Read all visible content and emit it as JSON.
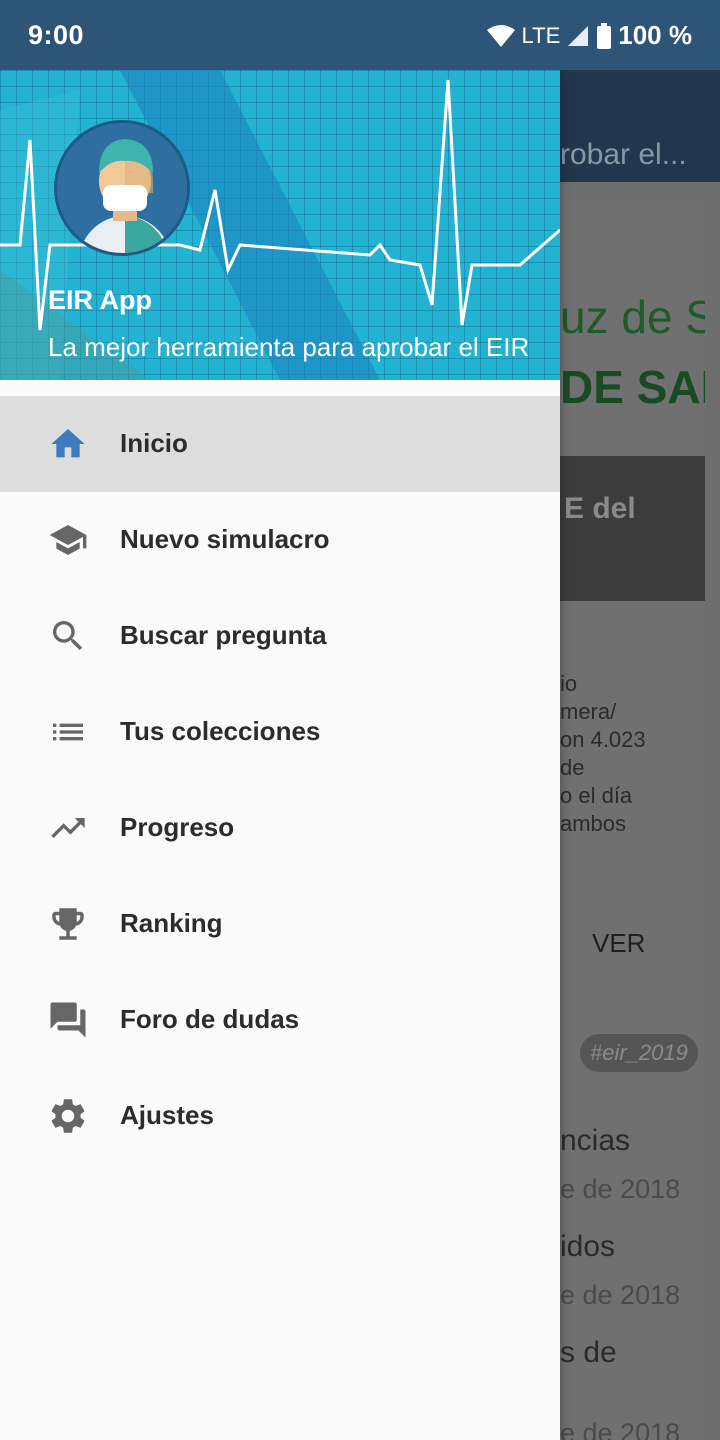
{
  "status_bar": {
    "time": "9:00",
    "network": "LTE",
    "battery": "100 %"
  },
  "background": {
    "toolbar_title": "robar el...",
    "banner_text_1": "uz de Sa",
    "banner_text_2": "DE SAL",
    "card_heading": "E del",
    "card_body_lines": [
      "io",
      "mera/",
      "on 4.023",
      "de",
      "o el día",
      "ambos"
    ],
    "card_action": "VER",
    "tag": "#eir_2019",
    "list_lines": [
      "ncias",
      "idos",
      "s de"
    ],
    "list_dates": [
      "e de 2018",
      "e de 2018",
      "e de 2018"
    ]
  },
  "drawer": {
    "app_name": "EIR App",
    "app_subtitle": "La mejor herramienta para aprobar el EIR",
    "items": [
      {
        "label": "Inicio",
        "icon": "home-icon",
        "active": true
      },
      {
        "label": "Nuevo simulacro",
        "icon": "school-icon",
        "active": false
      },
      {
        "label": "Buscar pregunta",
        "icon": "search-icon",
        "active": false
      },
      {
        "label": "Tus colecciones",
        "icon": "list-icon",
        "active": false
      },
      {
        "label": "Progreso",
        "icon": "trending-up-icon",
        "active": false
      },
      {
        "label": "Ranking",
        "icon": "trophy-icon",
        "active": false
      },
      {
        "label": "Foro de dudas",
        "icon": "forum-icon",
        "active": false
      },
      {
        "label": "Ajustes",
        "icon": "gear-icon",
        "active": false
      }
    ]
  },
  "colors": {
    "status_bar": "#2e5578",
    "header_cyan": "#23b2d2",
    "active_icon": "#3d7bbd",
    "icon_gray": "#666666"
  }
}
